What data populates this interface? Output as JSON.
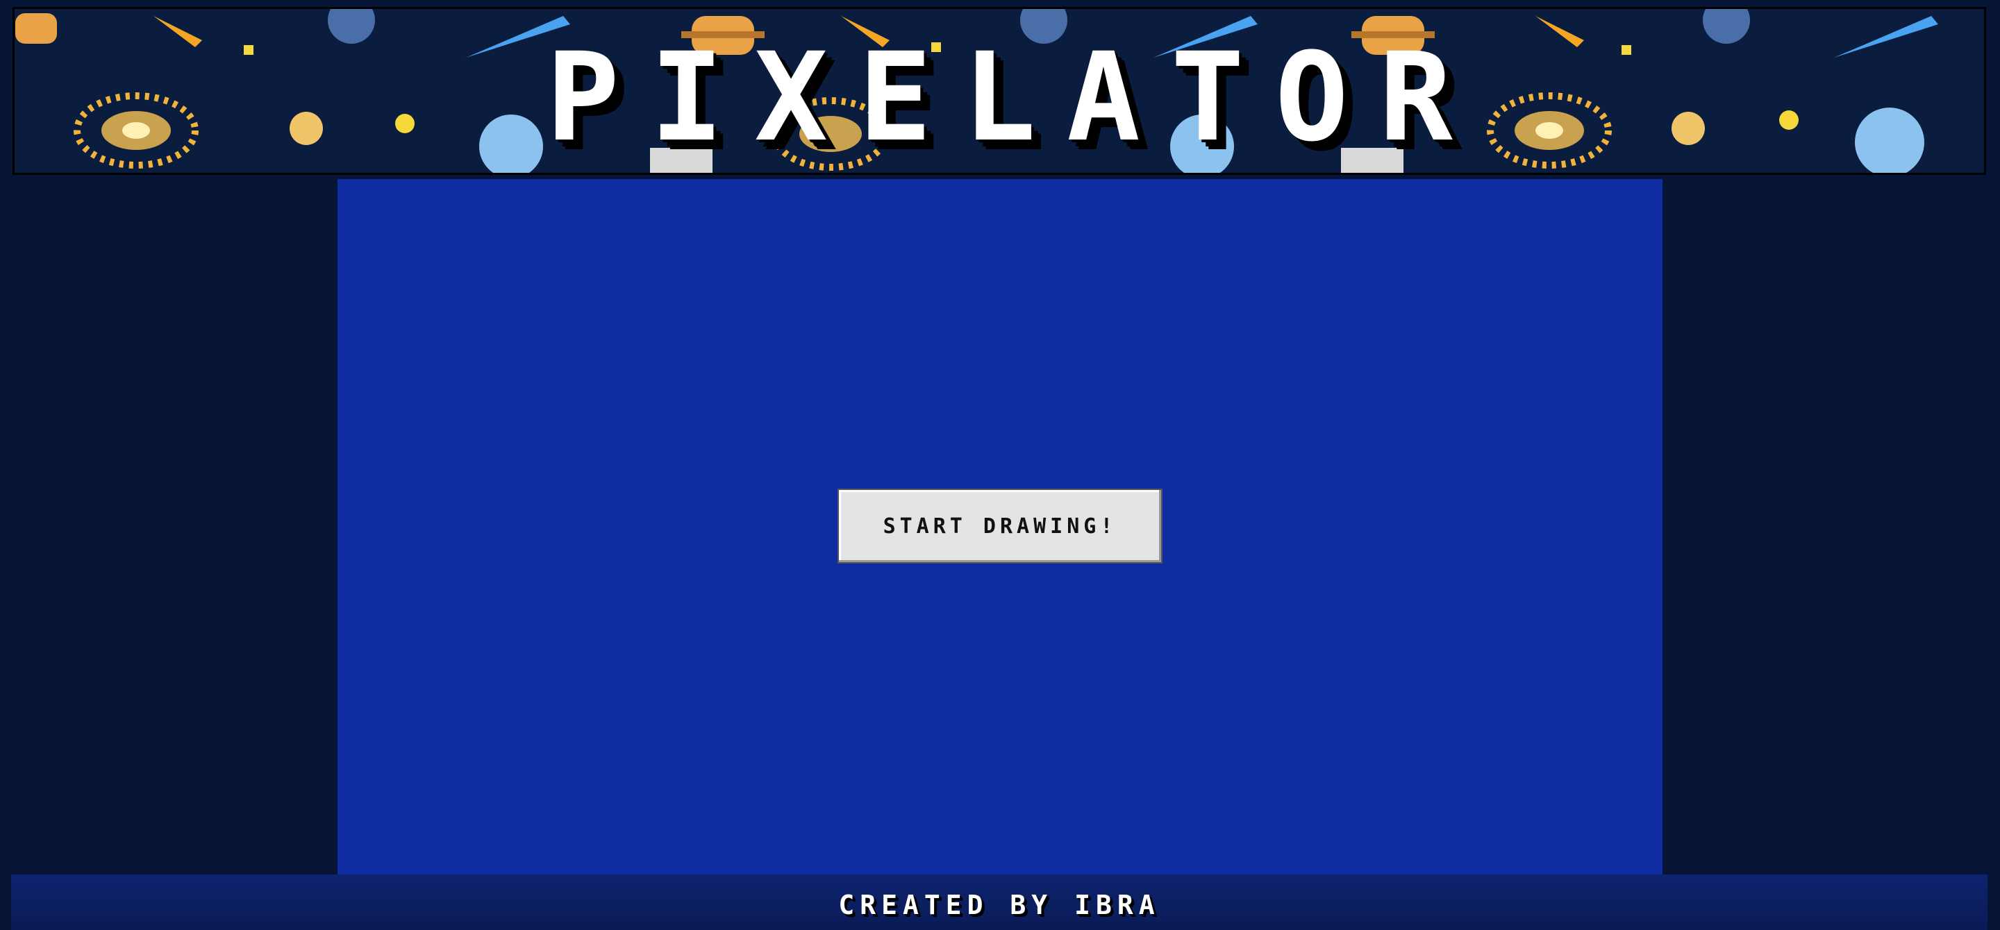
{
  "header": {
    "title": "PIXELATOR"
  },
  "main": {
    "start_button_label": "START DRAWING!"
  },
  "footer": {
    "credit": "CREATED BY IBRA"
  },
  "colors": {
    "page_background": "#061535",
    "header_background": "#0a1d3e",
    "canvas_background": "#0f2ca0",
    "button_background": "#e4e4e4",
    "footer_background": "#0d236e",
    "title_text": "#ffffff"
  },
  "icons": [
    "galaxy-icon",
    "planet-icon",
    "comet-icon",
    "star-icon",
    "rocket-icon"
  ]
}
